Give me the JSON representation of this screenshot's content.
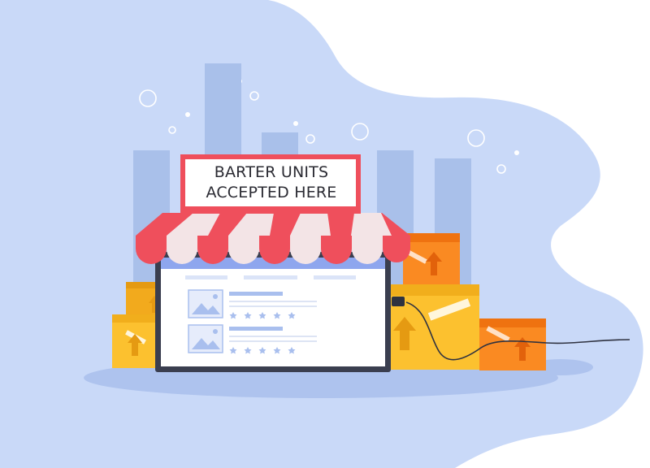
{
  "sign": {
    "line1": "BARTER UNITS",
    "line2": "ACCEPTED HERE"
  },
  "colors": {
    "blob": "#c9d9f8",
    "bars": "#a9c0ea",
    "awning_red": "#ef4f5c",
    "awning_light": "#f3e4e6",
    "monitor_frame": "#3a3e4f",
    "screen_header": "#8ea6ee",
    "box_yellow": "#fcc12f",
    "box_orange": "#fa8a22",
    "shadow": "#aec3ee"
  },
  "icons": {
    "stars": "star-icon",
    "image_placeholder": "image-placeholder-icon",
    "box_arrow": "arrow-up-icon",
    "power_cable": "power-cable-icon"
  },
  "listings": {
    "rating_stars_per_listing": 5
  }
}
